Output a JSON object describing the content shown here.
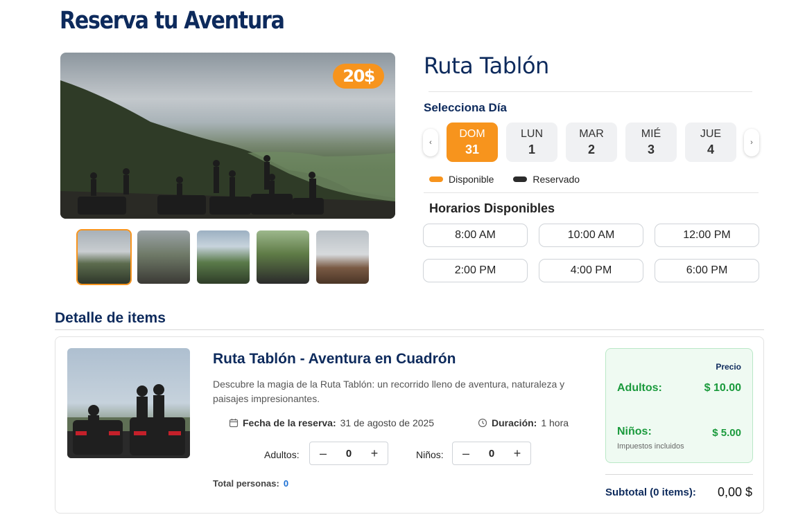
{
  "header": {
    "title": "Reserva tu Aventura"
  },
  "gallery": {
    "price_badge": "20$",
    "thumbnails": [
      "thumb-1",
      "thumb-2",
      "thumb-3",
      "thumb-4",
      "thumb-5"
    ],
    "active_index": 0
  },
  "booking": {
    "route_title": "Ruta Tablón",
    "select_day_label": "Selecciona Día",
    "prev_icon": "‹",
    "next_icon": "›",
    "days": [
      {
        "name": "DOM",
        "num": "31"
      },
      {
        "name": "LUN",
        "num": "1"
      },
      {
        "name": "MAR",
        "num": "2"
      },
      {
        "name": "MIÉ",
        "num": "3"
      },
      {
        "name": "JUE",
        "num": "4"
      }
    ],
    "active_day_index": 0,
    "legend": {
      "available": "Disponible",
      "reserved": "Reservado",
      "available_color": "#f7941d",
      "reserved_color": "#2b2b2b"
    },
    "slots_label": "Horarios Disponibles",
    "slots": [
      "8:00 AM",
      "10:00 AM",
      "12:00 PM",
      "2:00 PM",
      "4:00 PM",
      "6:00 PM"
    ]
  },
  "detail": {
    "section_label": "Detalle de items",
    "item": {
      "title": "Ruta Tablón - Aventura en Cuadrón",
      "description": "Descubre la magia de la Ruta Tablón: un recorrido lleno de aventura, naturaleza y paisajes impresionantes.",
      "date_label": "Fecha de la reserva:",
      "date_value": "31 de agosto de 2025",
      "duration_label": "Duración:",
      "duration_value": "1 hora",
      "adults_label": "Adultos:",
      "adults_value": "0",
      "kids_label": "Niños:",
      "kids_value": "0",
      "minus": "–",
      "plus": "+",
      "total_persons_label": "Total personas:",
      "total_persons_value": "0"
    },
    "price": {
      "header": "Precio",
      "adults_label": "Adultos:",
      "adults_price": "$ 10.00",
      "kids_label": "Niños:",
      "kids_price": "$ 5.00",
      "tax_note": "Impuestos incluidos"
    },
    "subtotal_label": "Subtotal (0 items):",
    "subtotal_value": "0,00 $"
  }
}
